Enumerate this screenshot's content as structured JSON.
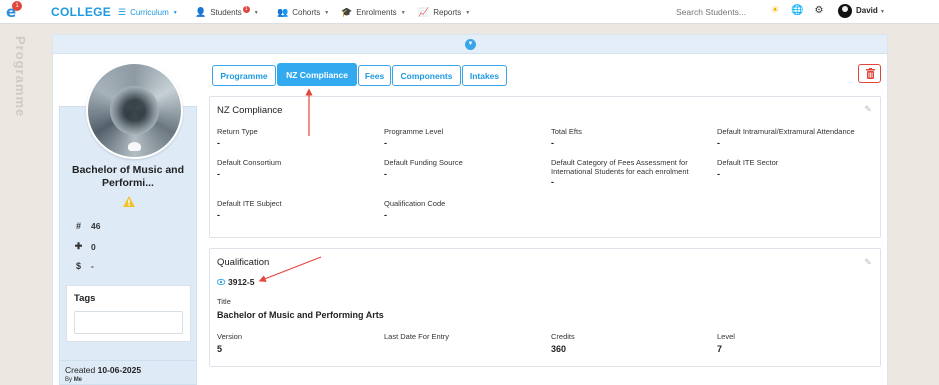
{
  "nav": {
    "logo_badge": "1",
    "brand": "COLLEGE",
    "items": [
      {
        "label": "Curriculum",
        "icon": "list-icon",
        "active": true
      },
      {
        "label": "Students",
        "icon": "user-icon",
        "badge": "1"
      },
      {
        "label": "Cohorts",
        "icon": "users-icon"
      },
      {
        "label": "Enrolments",
        "icon": "graduation-cap-icon"
      },
      {
        "label": "Reports",
        "icon": "chart-line-icon"
      }
    ],
    "search_placeholder": "Search Students...",
    "username": "David"
  },
  "side_label": "Programme",
  "programme": {
    "name_line1": "Bachelor of Music and",
    "name_line2": "Performi...",
    "stats": [
      {
        "icon": "hash-icon",
        "value": "46"
      },
      {
        "icon": "puzzle-icon",
        "value": "0"
      },
      {
        "icon": "dollar-icon",
        "value": "-"
      }
    ],
    "tags_title": "Tags",
    "created_label": "Created",
    "created_date": "10-06-2025",
    "by_label": "By",
    "by_user": "Me"
  },
  "tabs": [
    {
      "label": "Programme"
    },
    {
      "label": "NZ Compliance",
      "active": true
    },
    {
      "label": "Fees"
    },
    {
      "label": "Components"
    },
    {
      "label": "Intakes"
    }
  ],
  "nz_compliance": {
    "title": "NZ Compliance",
    "fields": [
      {
        "label": "Return Type",
        "value": "-"
      },
      {
        "label": "Programme Level",
        "value": "-"
      },
      {
        "label": "Total Efts",
        "value": "-"
      },
      {
        "label": "Default Intramural/Extramural Attendance",
        "value": "-"
      },
      {
        "label": "Default Consortium",
        "value": "-"
      },
      {
        "label": "Default Funding Source",
        "value": "-"
      },
      {
        "label": "Default Category of Fees Assessment for",
        "label2": "International Students for each enrolment",
        "value": "-"
      },
      {
        "label": "Default ITE Sector",
        "value": "-"
      },
      {
        "label": "Default ITE Subject",
        "value": "-"
      },
      {
        "label": "Qualification Code",
        "value": "-"
      }
    ]
  },
  "qualification": {
    "title": "Qualification",
    "code": "3912-5",
    "title_label": "Title",
    "title_value": "Bachelor of Music and Performing Arts",
    "fields": [
      {
        "label": "Version",
        "value": "5"
      },
      {
        "label": "Last Date For Entry",
        "value": ""
      },
      {
        "label": "Credits",
        "value": "360"
      },
      {
        "label": "Level",
        "value": "7"
      }
    ]
  },
  "colors": {
    "accent": "#33aaf0",
    "brand": "#1e9ae0",
    "danger": "#e0463c",
    "annotation_arrow": "#e0463c"
  }
}
